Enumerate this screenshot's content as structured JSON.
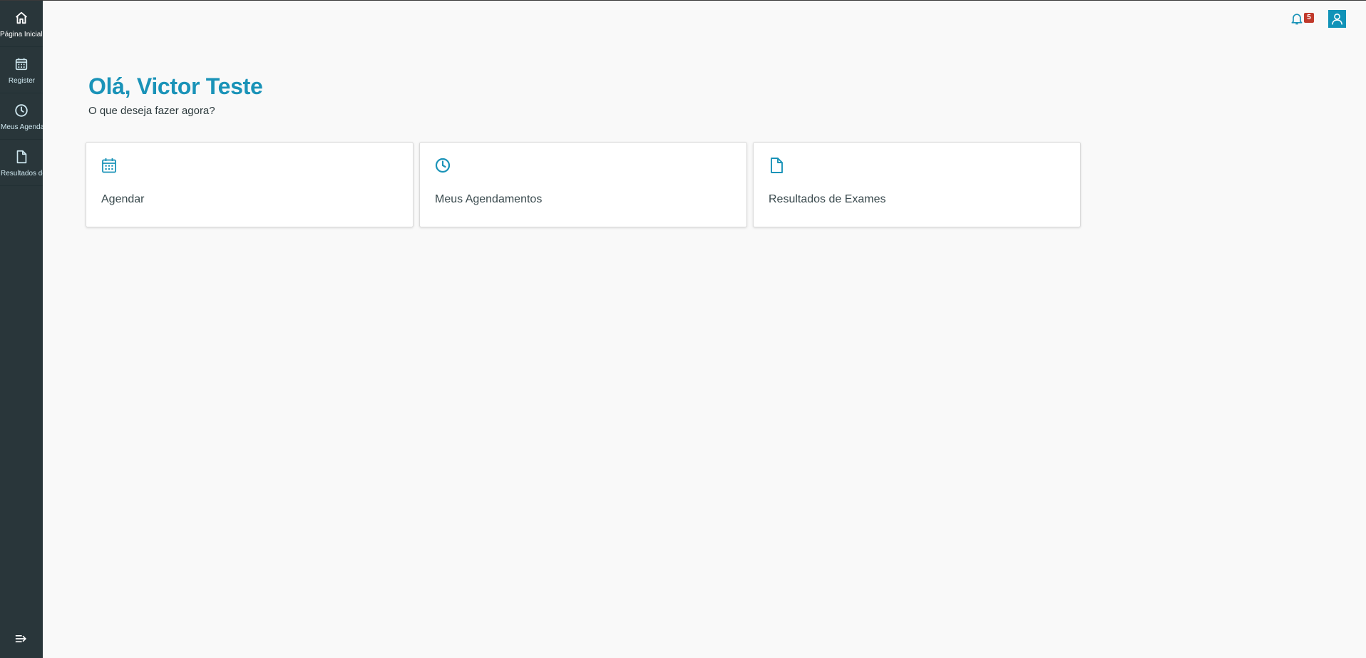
{
  "sidebar": {
    "items": [
      {
        "label": "Página Inicial",
        "icon": "home-icon",
        "active": true
      },
      {
        "label": "Register",
        "icon": "calendar-icon",
        "active": false
      },
      {
        "label": "Meus Agendamentos",
        "icon": "clock-icon",
        "active": false
      },
      {
        "label": "Resultados de Exames",
        "icon": "document-icon",
        "active": false
      }
    ],
    "collapse_icon": "collapse-menu-icon"
  },
  "header": {
    "notifications_count": "5",
    "notification_icon": "bell-icon",
    "user_icon": "user-icon"
  },
  "main": {
    "greeting": "Olá, Victor Teste",
    "subtitle": "O que deseja fazer agora?",
    "cards": [
      {
        "label": "Agendar",
        "icon": "calendar-icon"
      },
      {
        "label": "Meus Agendamentos",
        "icon": "clock-icon"
      },
      {
        "label": "Resultados de Exames",
        "icon": "document-icon"
      }
    ]
  },
  "colors": {
    "accent": "#1a93b8",
    "sidebar_bg": "#29363a",
    "badge": "#c0392b",
    "page_bg": "#f9f9f9"
  }
}
